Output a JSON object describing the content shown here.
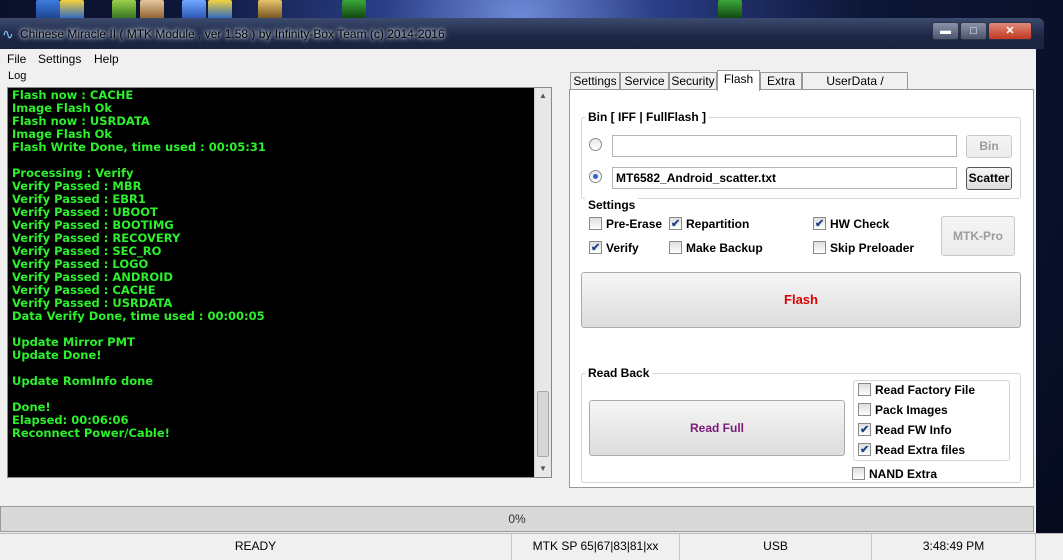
{
  "window": {
    "title": "Chinese Miracle II ( MTK Module , ver 1.58 ) by Infinity-Box Team (c) 2014-2016",
    "controls": [
      "minimize",
      "maximize",
      "close"
    ]
  },
  "menu": [
    "File",
    "Settings",
    "Help"
  ],
  "log": {
    "label": "Log",
    "lines": [
      "Flash now : CACHE",
      "Image Flash Ok",
      "Flash now : USRDATA",
      "Image Flash Ok",
      "Flash Write Done, time used : 00:05:31",
      "",
      "Processing : Verify",
      "Verify Passed : MBR",
      "Verify Passed : EBR1",
      "Verify Passed : UBOOT",
      "Verify Passed : BOOTIMG",
      "Verify Passed : RECOVERY",
      "Verify Passed : SEC_RO",
      "Verify Passed : LOGO",
      "Verify Passed : ANDROID",
      "Verify Passed : CACHE",
      "Verify Passed : USRDATA",
      "Data Verify Done, time used : 00:00:05",
      "",
      "Update Mirror PMT",
      "Update Done!",
      "",
      "Update RomInfo done",
      "",
      "Done!",
      "Elapsed: 00:06:06",
      "Reconnect Power/Cable!"
    ],
    "text_color": "#2cf02c"
  },
  "tabs": [
    "Settings",
    "Service",
    "Security",
    "Flash",
    "Extra",
    "UserData / Forensic"
  ],
  "active_tab": "Flash",
  "bin": {
    "group_label": "Bin  [ IFF | FullFlash ]",
    "bin_value": "",
    "bin_button": "Bin",
    "scatter_value": "MT6582_Android_scatter.txt",
    "scatter_button": "Scatter",
    "selected": "scatter"
  },
  "settings": {
    "group_label": "Settings",
    "options": [
      {
        "label": "Pre-Erase",
        "checked": false
      },
      {
        "label": "Repartition",
        "checked": true
      },
      {
        "label": "HW Check",
        "checked": true
      },
      {
        "label": "Verify",
        "checked": true
      },
      {
        "label": "Make Backup",
        "checked": false
      },
      {
        "label": "Skip Preloader",
        "checked": false
      }
    ],
    "mtk_pro_button": "MTK-Pro"
  },
  "flash_button": "Flash",
  "flash_button_color": "#e00000",
  "read_back": {
    "group_label": "Read Back",
    "read_full_button": "Read Full",
    "read_full_color": "#7b1a7b",
    "options": [
      {
        "label": "Read Factory File",
        "checked": false
      },
      {
        "label": "Pack Images",
        "checked": false
      },
      {
        "label": "Read FW Info",
        "checked": true
      },
      {
        "label": "Read Extra files",
        "checked": true
      }
    ],
    "nand_extra": {
      "label": "NAND Extra",
      "checked": false
    }
  },
  "progress": {
    "text": "0%",
    "value": 0
  },
  "status": {
    "state": "READY",
    "module": "MTK SP 65|67|83|81|xx",
    "port": "USB",
    "time": "3:48:49 PM"
  }
}
